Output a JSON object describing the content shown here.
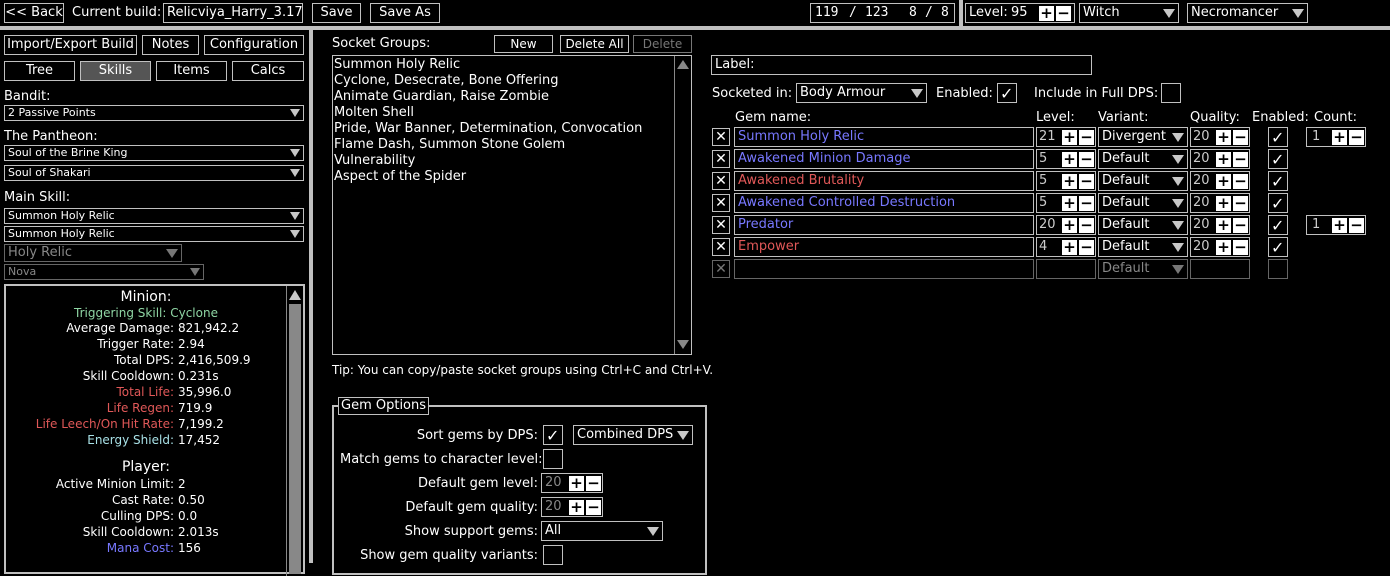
{
  "topbar": {
    "back_label": "<< Back",
    "current_build_label": "Current build:",
    "build_name": "Relicviya_Harry_3.17",
    "save_label": "Save",
    "save_as_label": "Save As",
    "points_used": "119",
    "points_total": "123",
    "ascend_used": "8",
    "ascend_total": "8",
    "level_label": "Level:",
    "level_value": "95",
    "class_value": "Witch",
    "ascendancy_value": "Necromancer"
  },
  "left": {
    "import_export_label": "Import/Export Build",
    "notes_label": "Notes",
    "configuration_label": "Configuration",
    "tabs": [
      "Tree",
      "Skills",
      "Items",
      "Calcs"
    ],
    "active_tab": "Skills",
    "bandit_label": "Bandit:",
    "bandit_value": "2 Passive Points",
    "pantheon_label": "The Pantheon:",
    "pantheon_major": "Soul of the Brine King",
    "pantheon_minor": "Soul of Shakari",
    "main_skill_label": "Main Skill:",
    "main_skill_group": "Summon Holy Relic",
    "main_skill_gem": "Summon Holy Relic",
    "main_skill_part": "Holy Relic",
    "main_skill_minion": "Nova",
    "stats": {
      "minion_header": "Minion:",
      "triggering_skill": "Triggering Skill: Cyclone",
      "minion_rows": [
        {
          "label": "Average Damage:",
          "value": "821,942.2",
          "color": "#ffffff"
        },
        {
          "label": "Trigger Rate:",
          "value": "2.94",
          "color": "#ffffff"
        },
        {
          "label": "Total DPS:",
          "value": "2,416,509.9",
          "color": "#ffffff"
        },
        {
          "label": "Skill Cooldown:",
          "value": "0.231s",
          "color": "#ffffff"
        },
        {
          "label": "Total Life:",
          "value": "35,996.0",
          "color": "#e05858"
        },
        {
          "label": "Life Regen:",
          "value": "719.9",
          "color": "#e05858"
        },
        {
          "label": "Life Leech/On Hit Rate:",
          "value": "7,199.2",
          "color": "#e05858"
        },
        {
          "label": "Energy Shield:",
          "value": "17,452",
          "color": "#a8e0e6"
        }
      ],
      "player_header": "Player:",
      "player_rows": [
        {
          "label": "Active Minion Limit:",
          "value": "2",
          "color": "#ffffff"
        },
        {
          "label": "Cast Rate:",
          "value": "0.50",
          "color": "#ffffff"
        },
        {
          "label": "Culling DPS:",
          "value": "0.0",
          "color": "#ffffff"
        },
        {
          "label": "Skill Cooldown:",
          "value": "2.013s",
          "color": "#ffffff"
        },
        {
          "label": "Mana Cost:",
          "value": "156",
          "color": "#7878ff"
        }
      ]
    }
  },
  "socket_groups": {
    "header": "Socket Groups:",
    "new_label": "New",
    "delete_all_label": "Delete All",
    "delete_label": "Delete",
    "items": [
      "Summon Holy Relic",
      "Cyclone, Desecrate, Bone Offering",
      "Animate Guardian, Raise Zombie",
      "Molten Shell",
      "Pride, War Banner, Determination, Convocation",
      "Flame Dash, Summon Stone Golem",
      "Vulnerability",
      "Aspect of the Spider"
    ],
    "tip": "Tip: You can copy/paste socket groups using Ctrl+C and Ctrl+V."
  },
  "gem_options": {
    "legend": "Gem Options",
    "sort_label": "Sort gems by DPS:",
    "sort_mode": "Combined DPS",
    "match_level_label": "Match gems to character level:",
    "default_level_label": "Default gem level:",
    "default_level": "20",
    "default_quality_label": "Default gem quality:",
    "default_quality": "20",
    "show_support_label": "Show support gems:",
    "show_support_value": "All",
    "show_variants_label": "Show gem quality variants:"
  },
  "group_detail": {
    "label_label": "Label:",
    "label_value": "",
    "socketed_label": "Socketed in:",
    "socketed_value": "Body Armour",
    "enabled_label": "Enabled:",
    "full_dps_label": "Include in Full DPS:",
    "columns": {
      "name": "Gem name:",
      "level": "Level:",
      "variant": "Variant:",
      "quality": "Quality:",
      "enabled": "Enabled:",
      "count": "Count:"
    },
    "gems": [
      {
        "name": "Summon Holy Relic",
        "level": "21",
        "variant": "Divergent",
        "quality": "20",
        "count": "1",
        "color": "#7878ff"
      },
      {
        "name": "Awakened Minion Damage",
        "level": "5",
        "variant": "Default",
        "quality": "20",
        "count": "",
        "color": "#7878ff"
      },
      {
        "name": "Awakened Brutality",
        "level": "5",
        "variant": "Default",
        "quality": "20",
        "count": "",
        "color": "#e05858"
      },
      {
        "name": "Awakened Controlled Destruction",
        "level": "5",
        "variant": "Default",
        "quality": "20",
        "count": "",
        "color": "#7878ff"
      },
      {
        "name": "Predator",
        "level": "20",
        "variant": "Default",
        "quality": "20",
        "count": "1",
        "color": "#7878ff"
      },
      {
        "name": "Empower",
        "level": "4",
        "variant": "Default",
        "quality": "20",
        "count": "",
        "color": "#e05858"
      }
    ],
    "empty_variant": "Default"
  }
}
